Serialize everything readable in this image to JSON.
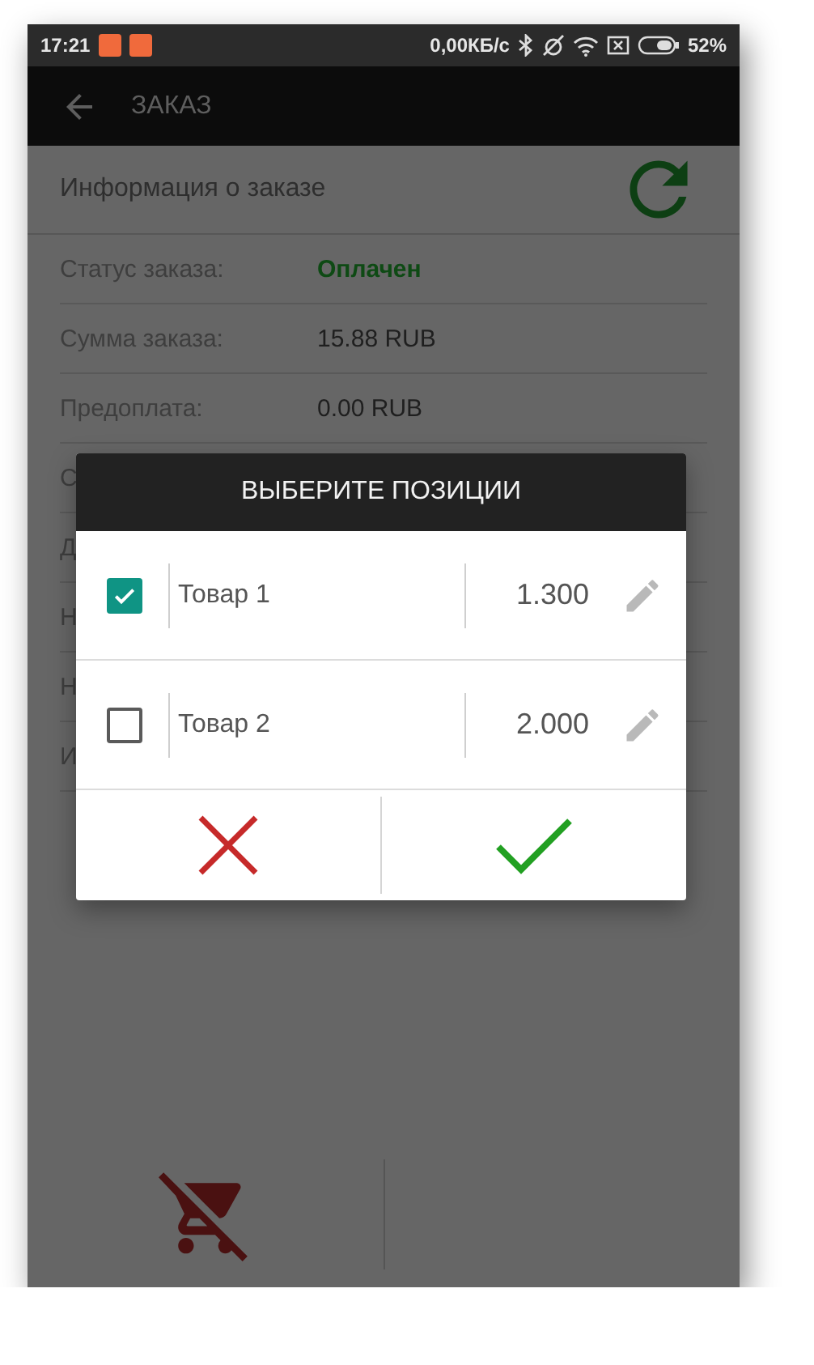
{
  "status_bar": {
    "time": "17:21",
    "speed": "0,00КБ/с",
    "battery_percent": "52%"
  },
  "toolbar": {
    "title": "ЗАКАЗ"
  },
  "section": {
    "title": "Информация о заказе"
  },
  "info_rows": [
    {
      "label": "Статус заказа:",
      "value": "Оплачен",
      "kind": "status"
    },
    {
      "label": "Сумма заказа:",
      "value": "15.88 RUB",
      "kind": "plain"
    },
    {
      "label": "Предоплата:",
      "value": "0.00 RUB",
      "kind": "plain"
    },
    {
      "label": "С"
    },
    {
      "label": "Д"
    },
    {
      "label": "Н"
    },
    {
      "label": "Н"
    },
    {
      "label": "И"
    }
  ],
  "dialog": {
    "title": "ВЫБЕРИТЕ ПОЗИЦИИ",
    "items": [
      {
        "name": "Товар 1",
        "quantity": "1.300",
        "checked": true
      },
      {
        "name": "Товар 2",
        "quantity": "2.000",
        "checked": false
      }
    ]
  }
}
